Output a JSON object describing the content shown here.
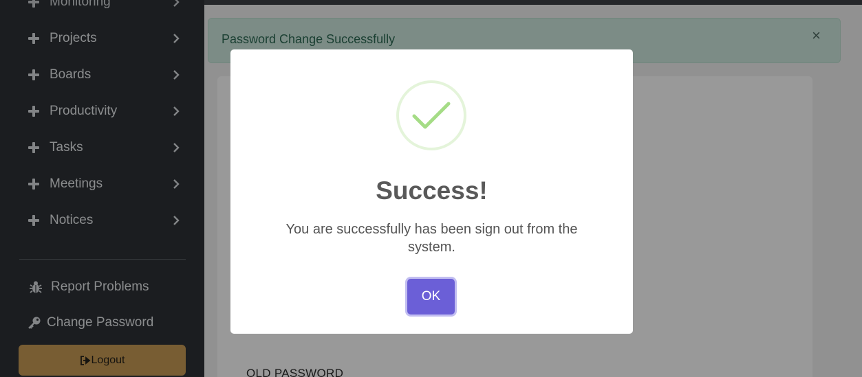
{
  "sidebar": {
    "partial_item": "Monitoring",
    "items": [
      {
        "label": "Projects"
      },
      {
        "label": "Boards"
      },
      {
        "label": "Productivity"
      },
      {
        "label": "Tasks"
      },
      {
        "label": "Meetings"
      },
      {
        "label": "Notices"
      }
    ],
    "report_problems": "Report Problems",
    "change_password": "Change Password",
    "logout": "Logout"
  },
  "alert": {
    "message": "Password Change Successfully",
    "close": "×"
  },
  "form": {
    "old_password_label": "OLD PASSWORD"
  },
  "modal": {
    "title": "Success!",
    "text": "You are successfully has been sign out from the system.",
    "ok": "OK"
  },
  "colors": {
    "sidebar_bg": "#2d3136",
    "logout_bg": "#c99b55",
    "ok_button": "#6b5fd7",
    "success_check": "#a5dc86",
    "alert_bg": "#cfe9df"
  },
  "icons": {
    "menu_expand": "plus-icon",
    "menu_arrow": "chevron-right-icon",
    "report": "bug-icon",
    "password": "key-icon",
    "logout": "sign-out-icon",
    "success": "check-icon"
  }
}
